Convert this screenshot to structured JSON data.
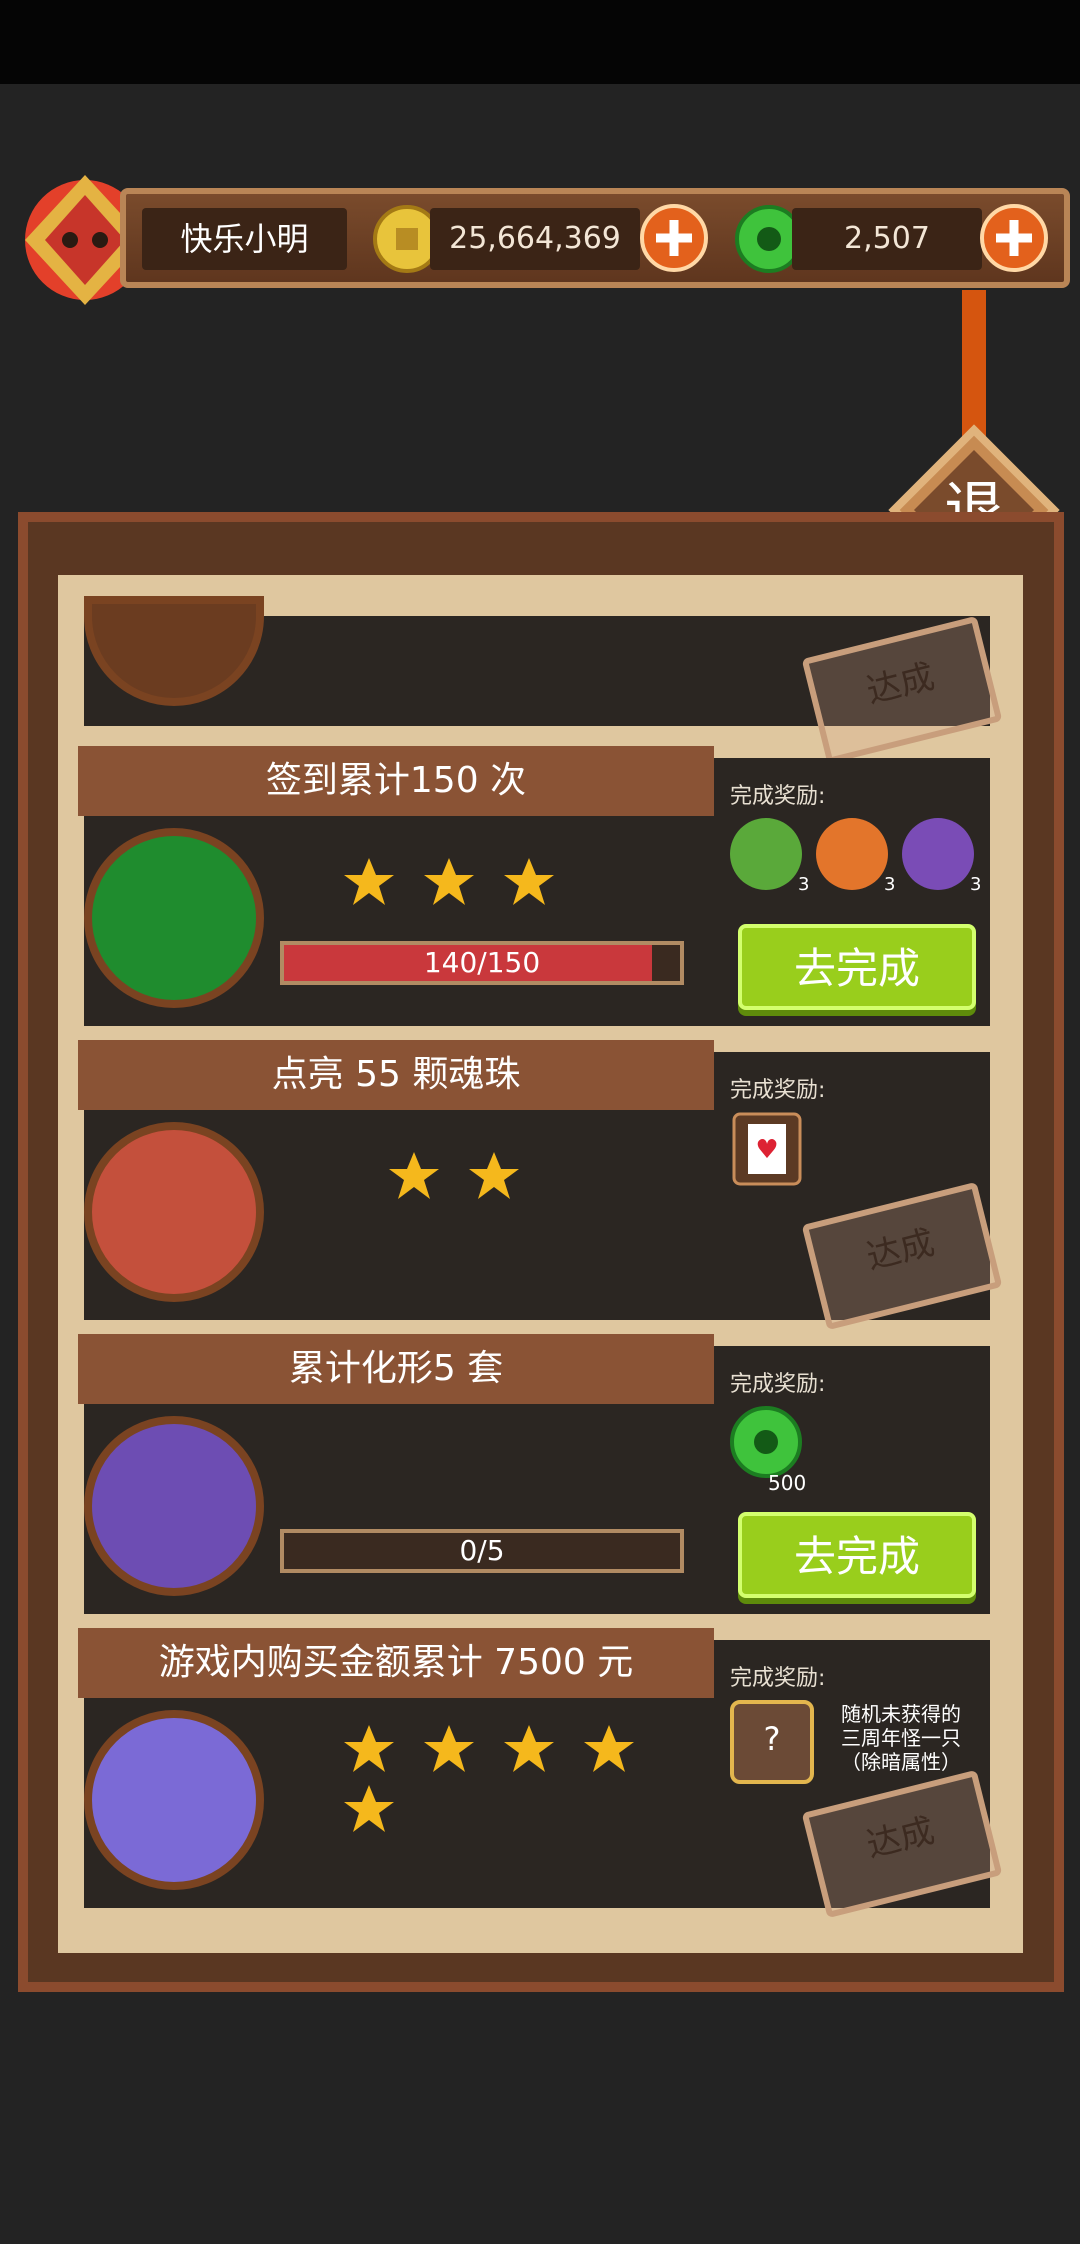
{
  "player": {
    "name": "快乐小明"
  },
  "currencies": {
    "gold": {
      "value": "25,664,369"
    },
    "jade": {
      "value": "2,507"
    }
  },
  "exit_label": "退",
  "reward_label": "完成奖励:",
  "go_button_label": "去完成",
  "stamp_label": "达成",
  "tasks": [
    {
      "stamp": "达成"
    },
    {
      "title": "签到累计150 次",
      "stars": 3,
      "progress": "140/150",
      "progress_value": 140,
      "progress_max": 150,
      "rewards": [
        "3",
        "3",
        "3"
      ],
      "action": "去完成"
    },
    {
      "title": "点亮 55 颗魂珠",
      "stars": 2,
      "stamp": "达成"
    },
    {
      "title": "累计化形5 套",
      "progress": "0/5",
      "progress_value": 0,
      "progress_max": 5,
      "rewards": [
        "500"
      ],
      "action": "去完成"
    },
    {
      "title": "游戏内购买金额累计 7500 元",
      "stars": 5,
      "stamp": "达成",
      "reward_desc": [
        "随机未获得的",
        "三周年怪一只",
        "（除暗属性）"
      ]
    }
  ],
  "colors": {
    "accent_green": "#99ce1c",
    "frame": "#8b4b2e",
    "paper": "#dfc79f"
  }
}
